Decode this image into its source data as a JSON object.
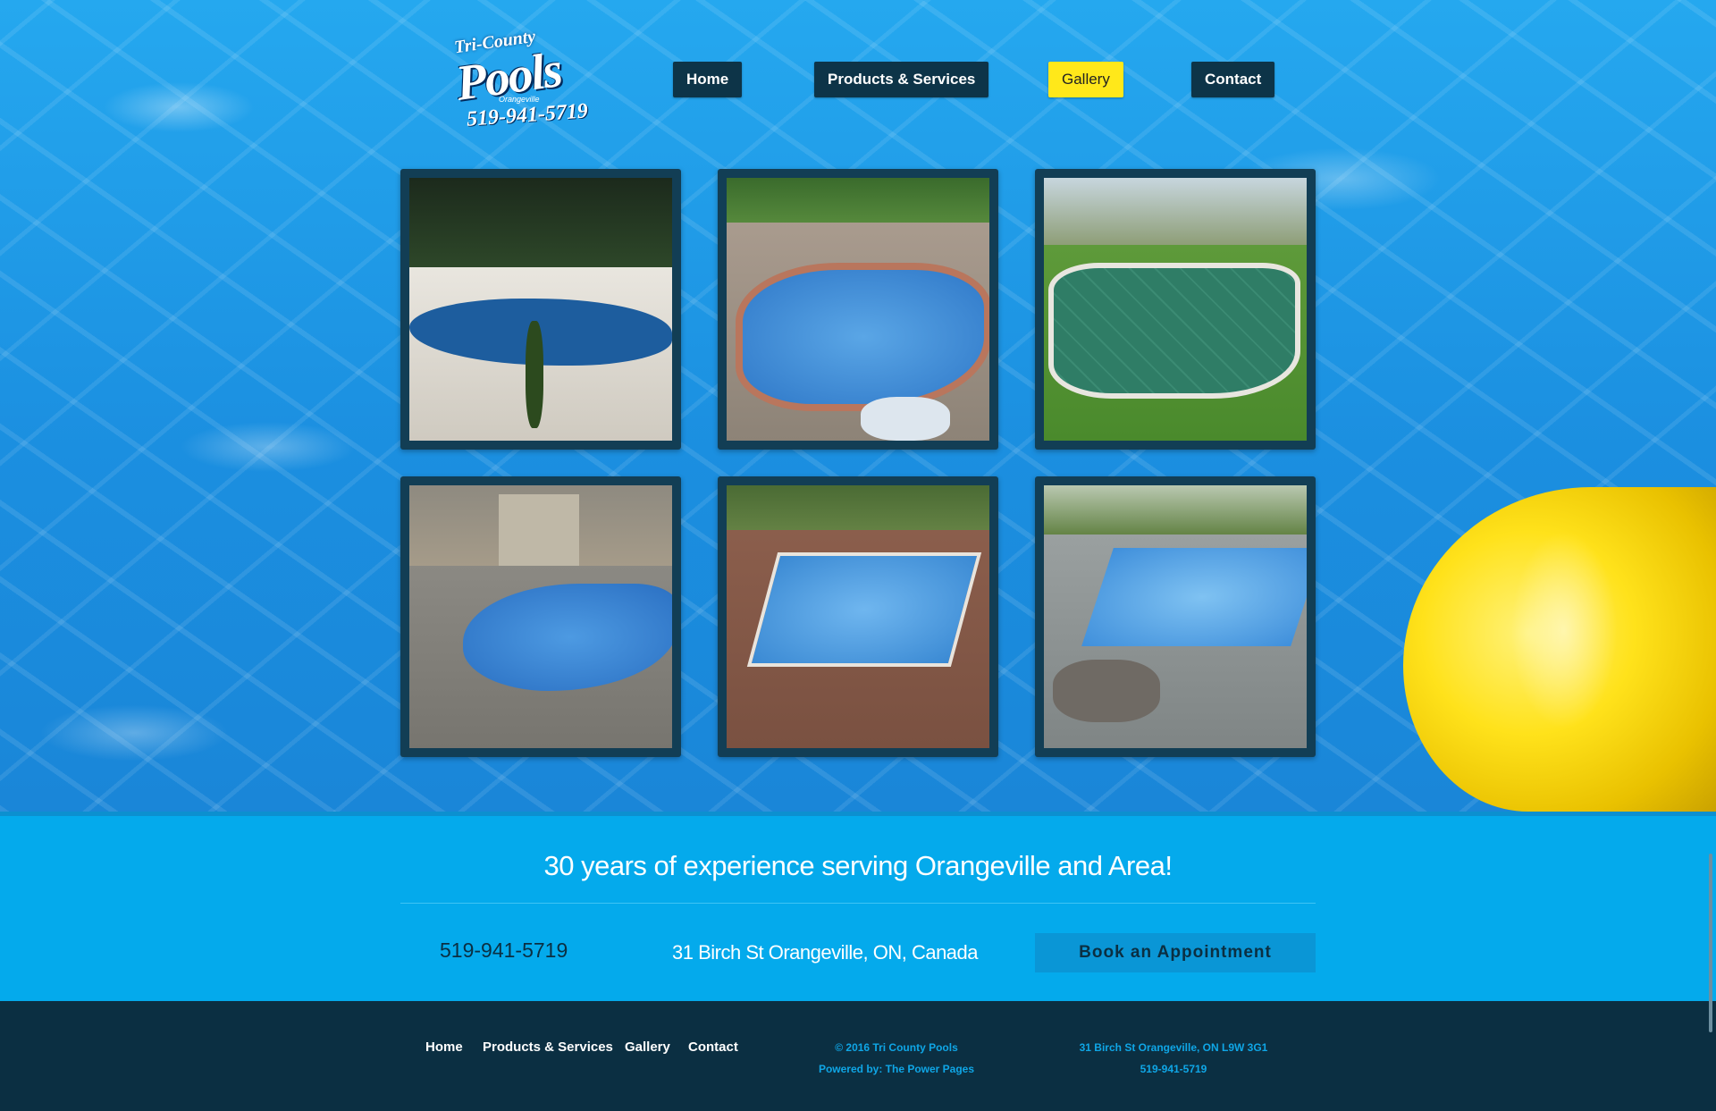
{
  "logo": {
    "line1": "Tri-County",
    "line2": "Pools",
    "line3": "Orangeville",
    "line4": "519-941-5719"
  },
  "nav": {
    "items": [
      {
        "label": "Home"
      },
      {
        "label": "Products & Services"
      },
      {
        "label": "Gallery",
        "active": true
      },
      {
        "label": "Contact"
      }
    ]
  },
  "info": {
    "tagline": "30 years of experience serving Orangeville and Area!",
    "phone": "519-941-5719",
    "address": "31 Birch St Orangeville, ON, Canada",
    "book_label": "Book an Appointment"
  },
  "footer": {
    "links": [
      "Home",
      "Products & Services",
      "Gallery",
      "Contact"
    ],
    "copyright": "© 2016 Tri County Pools",
    "powered": "Powered by: The Power Pages",
    "address": "31 Birch St Orangeville, ON L9W 3G1",
    "phone": "519-941-5719"
  },
  "colors": {
    "nav_bg": "#0d3448",
    "nav_active": "#ffe81a",
    "band": "#04aaec",
    "footer_bg": "#0b2f42",
    "footer_text": "#0fa6e6"
  }
}
